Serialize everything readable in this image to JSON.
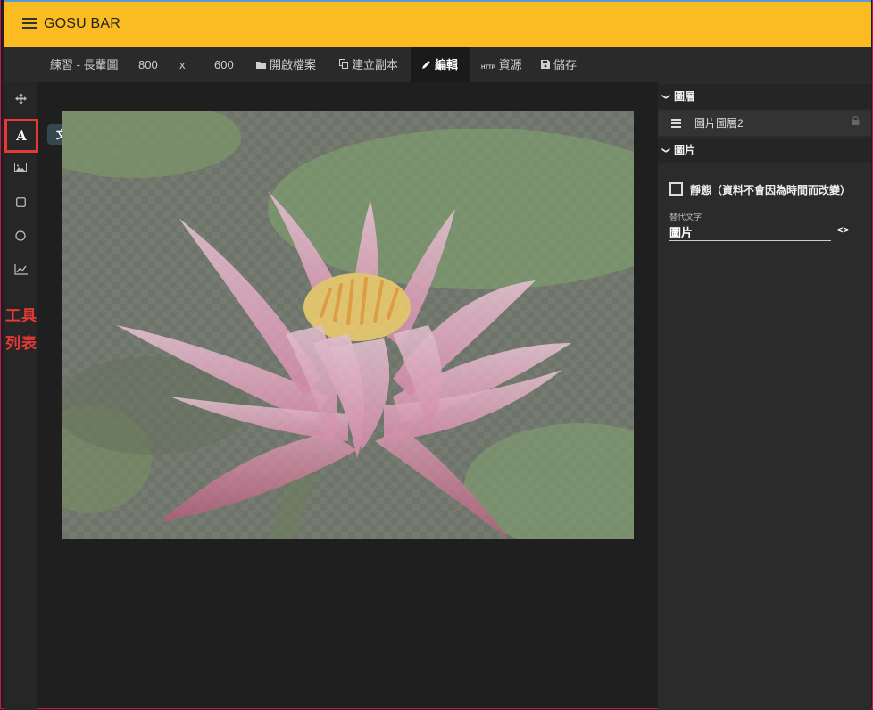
{
  "app": {
    "title": "GOSU BAR"
  },
  "toolbar": {
    "name": "練習 - 長輩圖",
    "width": "800",
    "times": "x",
    "height": "600",
    "open_label": "開啟檔案",
    "duplicate_label": "建立副本",
    "edit_label": "編輯",
    "resource_label": "資源",
    "save_label": "儲存"
  },
  "tools": {
    "text_letter": "A",
    "tooltip": "文字",
    "annotation_line1": "工具",
    "annotation_line2": "列表"
  },
  "panel": {
    "layers_heading": "圖層",
    "layer_name": "圖片圖層2",
    "image_heading": "圖片",
    "static_label": "靜態（資料不會因為時間而改變）",
    "alt_label": "替代文字",
    "alt_value": "圖片",
    "code_toggle": "<>"
  },
  "colors": {
    "appbar": "#fbbc22",
    "highlight": "#e53935"
  },
  "icons": [
    "menu-icon",
    "folder-icon",
    "copy-icon",
    "pencil-icon",
    "http-icon",
    "floppy-icon",
    "move-icon",
    "image-icon",
    "square-icon",
    "circle-icon",
    "chart-icon",
    "lock-icon",
    "chevron-down-icon"
  ]
}
